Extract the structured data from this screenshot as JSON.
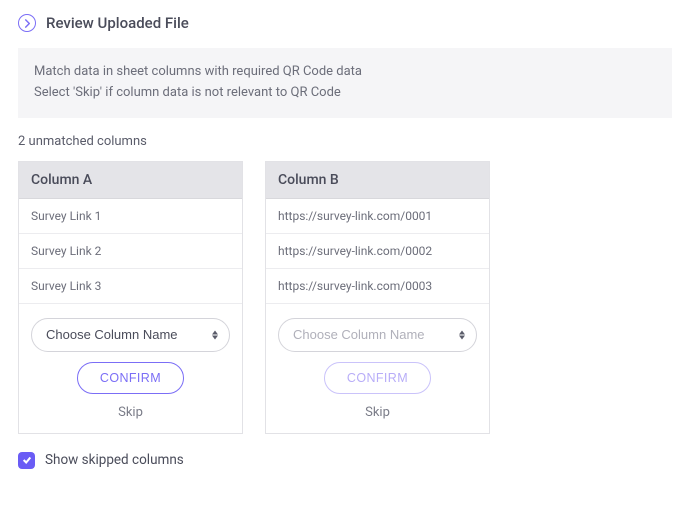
{
  "header": {
    "title": "Review Uploaded File"
  },
  "info": {
    "line1": "Match data in sheet columns with required QR Code data",
    "line2": "Select 'Skip' if column data is not relevant to QR Code"
  },
  "status": "2 unmatched columns",
  "columns": [
    {
      "title": "Column A",
      "rows": [
        "Survey Link 1",
        "Survey Link 2",
        "Survey Link 3"
      ],
      "select_placeholder": "Choose Column Name",
      "confirm_label": "CONFIRM",
      "skip_label": "Skip",
      "muted": false
    },
    {
      "title": "Column B",
      "rows": [
        "https://survey-link.com/0001",
        "https://survey-link.com/0002",
        "https://survey-link.com/0003"
      ],
      "select_placeholder": "Choose Column Name",
      "confirm_label": "CONFIRM",
      "skip_label": "Skip",
      "muted": true
    }
  ],
  "checkbox": {
    "label": "Show skipped columns",
    "checked": true
  }
}
